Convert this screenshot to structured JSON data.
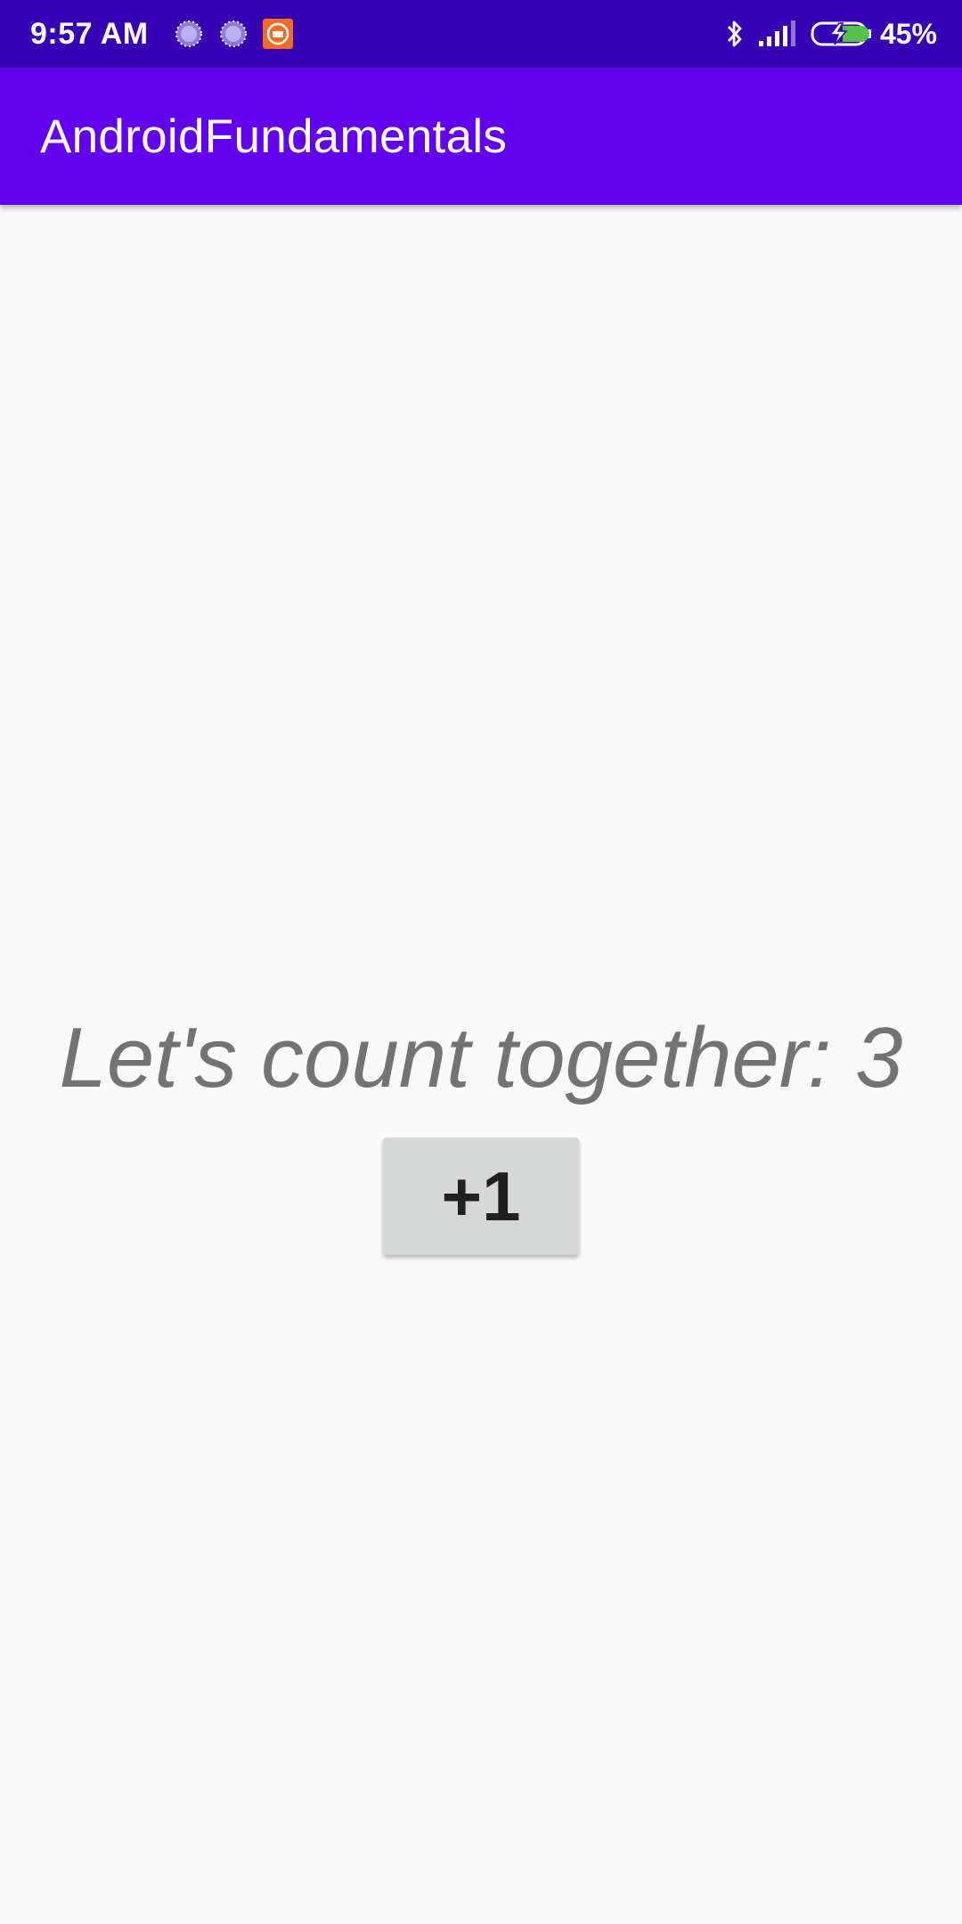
{
  "status_bar": {
    "time": "9:57 AM",
    "notification_icons": [
      "loading-icon",
      "loading-icon",
      "mi-app-icon"
    ],
    "bluetooth_icon": "bluetooth-icon",
    "signal_icon": "cell-signal-icon",
    "battery_icon": "battery-charging-icon",
    "battery_percent": "45%",
    "background_color": "#3700b3"
  },
  "app_bar": {
    "title": "AndroidFundamentals",
    "background_color": "#6200ee"
  },
  "main": {
    "counter_label": "Let's count together: 3",
    "increment_button_label": "+1"
  }
}
